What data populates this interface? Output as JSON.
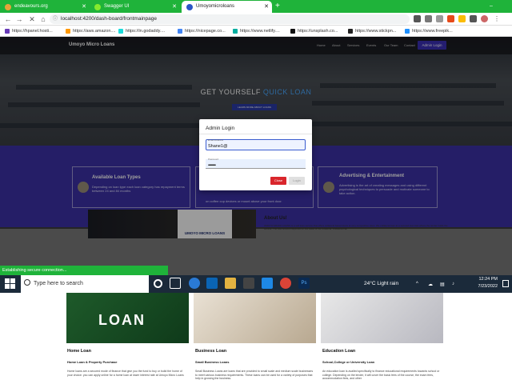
{
  "browser": {
    "tabs": [
      {
        "label": "endeavours.org",
        "active": false
      },
      {
        "label": "Swagger UI",
        "active": false
      },
      {
        "label": "Umoyomicroloans",
        "active": true
      }
    ],
    "new_tab": "+",
    "url": "localhost:4200/dash-board/frontmainpage",
    "bookmarks": [
      "https://hpanel.hosti...",
      "https://aws.amazon....",
      "https://in.godaddy....",
      "https://nicepage.co...",
      "https://www.netlify....",
      "https://unsplash.co...",
      "https://www.stickpn...",
      "https://www.freepik..."
    ],
    "status": "Establishing secure connection..."
  },
  "site": {
    "brand": "Umoyo Micro Loans",
    "nav": [
      "Home",
      "About",
      "Services",
      "Events",
      "Our Team",
      "Contact"
    ],
    "login_button": "Admin Login",
    "hero_title_a": "GET YOURSELF ",
    "hero_title_b": "QUICK LOAN",
    "hero_button": "LEARN MORE ABOUT LOANS",
    "cards": [
      {
        "title": "Available Loan Types",
        "text": "Depending on loan type each loan category has repayment terms between 24 and 84 months"
      },
      {
        "title": "",
        "text": "on coffee cup devices or mount above your front door."
      },
      {
        "title": "Advertising & Entertainment",
        "text": "Advertising is the art of creating messages and using different psychological techniques to persuade and motivate someone to take action."
      }
    ],
    "lower_logo": "UMOYO MICRO LOANS",
    "about_title": "About Us!",
    "about_text": "UMOYO MICRO LOANS is a self loan service that offers collateral based loans at very competitive rates. We collateral loan at a secured loan fast where the lender holds the vehicle. The loan amount depends on the value of the collateral. Collateral can"
  },
  "modal": {
    "title": "Admin Login",
    "email_label": "Email Address",
    "email_value": "Shane1@",
    "password_label": "Password",
    "password_value": "••••••••••••",
    "close": "Close",
    "login": "Login"
  },
  "taskbar": {
    "search_placeholder": "Type here to search",
    "weather": "24°C  Light rain",
    "time": "12:24 PM",
    "date": "7/23/2022"
  },
  "products": [
    {
      "title": "Home Loan",
      "subtitle": "Home Loan & Property Purchase",
      "text": "Home loans are a secured mode of finance that give you the fund to buy or build the home of your choice. you can apply online for a home loan at lower interest rate at Umoyo Micro Loans"
    },
    {
      "title": "Business Loan",
      "subtitle": "Small Business Loans",
      "text": "Small Business Loans are loans that are provided to small scale and medium scale businesses to meet various business requirements. These loans can be used for a variety of purposes that help in growing the business."
    },
    {
      "title": "Education Loan",
      "subtitle": "School,College or University Loan",
      "text": "An education loan is availed specifically to finance educational requirements towards school or college. Depending on the lender, it will cover the basic fees of the course, the exam fees, accommodation fees, and other"
    }
  ],
  "colors": {
    "browser_green": "#1fb33a",
    "brand_blue": "#3d31a6",
    "close_red": "#d9262c",
    "taskbar": "#1b2a3a"
  }
}
